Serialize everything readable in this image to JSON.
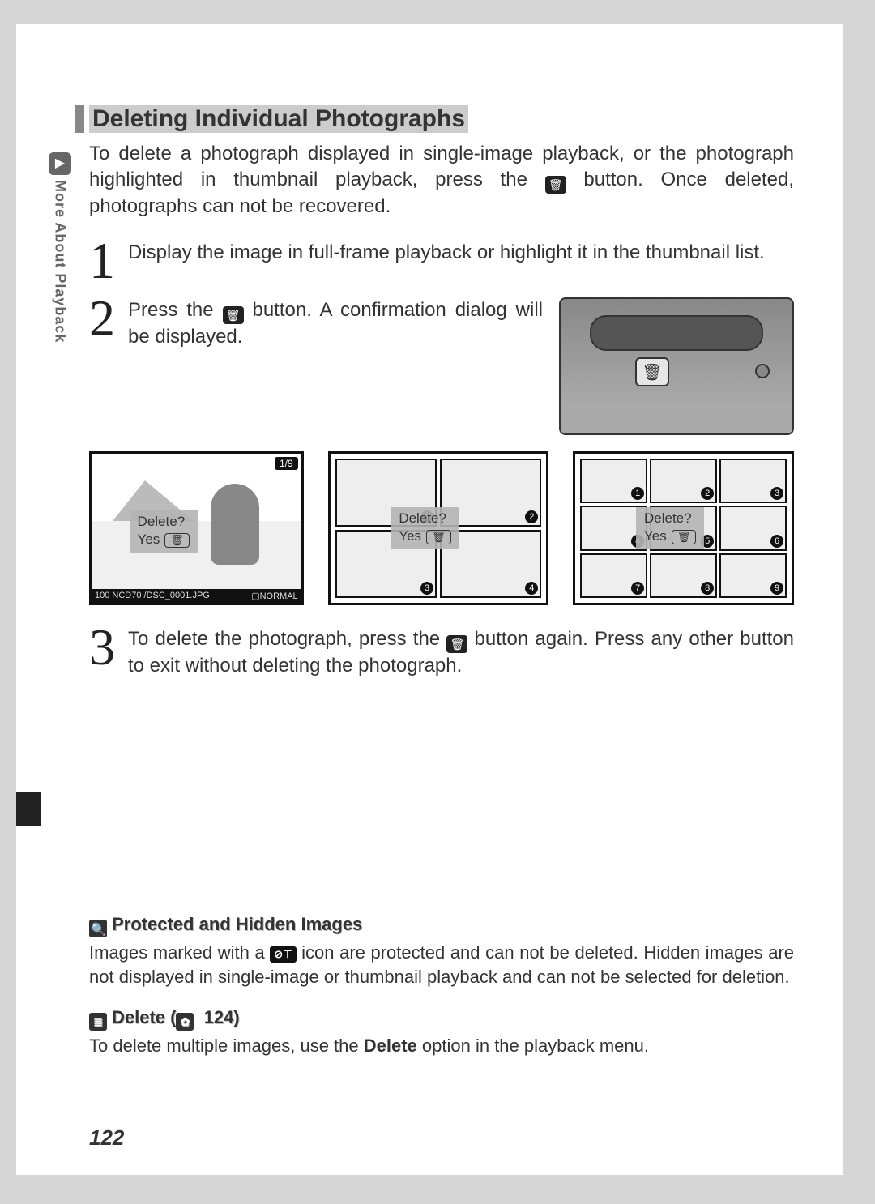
{
  "sidebar": {
    "label": "More About Playback"
  },
  "title": "Deleting Individual Photographs",
  "intro_a": "To delete a photograph displayed in single-image playback, or the photograph highlighted in thumbnail playback, press the ",
  "intro_b": " button.  Once deleted, photographs can not be recovered.",
  "steps": {
    "s1": "Display the image in full-frame playback or highlight it in the thumbnail list.",
    "s2_a": "Press the ",
    "s2_b": " button.  A confirmation dialog will be displayed.",
    "s3_a": "To delete the photograph, press the ",
    "s3_b": " button again.  Press any other button to exit without deleting the photograph."
  },
  "dialog": {
    "question": "Delete?",
    "yes": "Yes"
  },
  "thumb1": {
    "counter": "1/9",
    "folder": "100 NCD70 /DSC_0001.JPG",
    "quality": "NORMAL"
  },
  "grid4": [
    "1",
    "2",
    "3",
    "4"
  ],
  "grid9": [
    "1",
    "2",
    "3",
    "4",
    "5",
    "6",
    "7",
    "8",
    "9"
  ],
  "note1": {
    "title": "Protected and Hidden Images",
    "body_a": "Images marked with a ",
    "body_b": " icon are protected and can not be deleted.  Hidden images are not displayed in single-image or thumbnail playback and can not be selected for deletion."
  },
  "note2": {
    "title_a": "Delete (",
    "title_b": " 124)",
    "body_a": "To delete multiple images, use the ",
    "body_bold": "Delete",
    "body_b": " option in the playback menu."
  },
  "page_number": "122",
  "icons": {
    "trash": "🗑",
    "menu": "≣",
    "info": "🔍",
    "protect": "⊘⊤",
    "ref": "✿"
  }
}
